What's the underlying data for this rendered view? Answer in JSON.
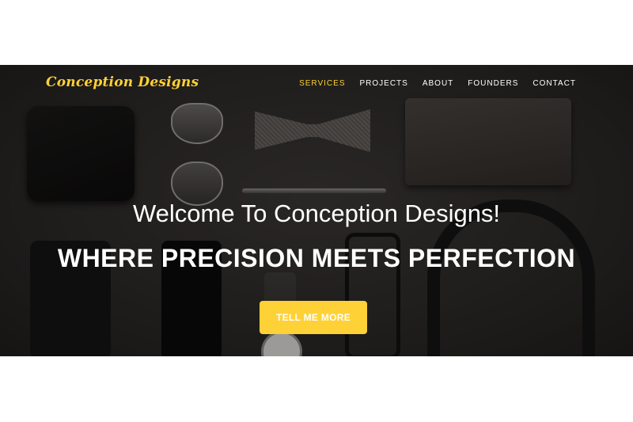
{
  "brand": {
    "name": "Conception Designs"
  },
  "nav": {
    "items": [
      {
        "label": "SERVICES",
        "active": true
      },
      {
        "label": "PROJECTS",
        "active": false
      },
      {
        "label": "ABOUT",
        "active": false
      },
      {
        "label": "FOUNDERS",
        "active": false
      },
      {
        "label": "CONTACT",
        "active": false
      }
    ]
  },
  "hero": {
    "welcome": "Welcome To Conception Designs!",
    "tagline": "WHERE PRECISION MEETS PERFECTION",
    "cta_label": "TELL ME MORE"
  },
  "colors": {
    "accent": "#fed136",
    "overlay": "#2b2927",
    "text": "#ffffff"
  }
}
